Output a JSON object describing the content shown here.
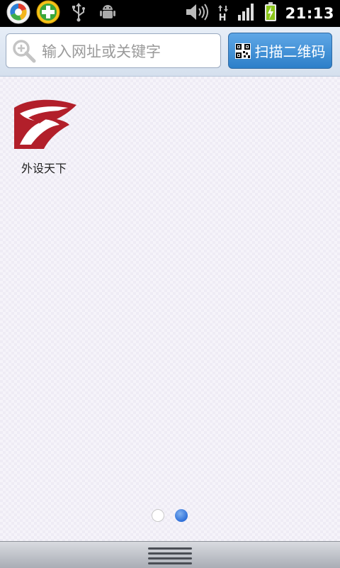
{
  "status_bar": {
    "time": "21:13",
    "left_icons": [
      "browser-app-icon",
      "plus-app-icon",
      "usb-icon",
      "android-debug-icon"
    ],
    "right_icons": [
      "volume-icon",
      "data-hsdpa-icon",
      "signal-icon",
      "battery-charging-icon"
    ],
    "network_label": "H"
  },
  "toolbar": {
    "search_placeholder": "输入网址或关键字",
    "scan_button_label": "扫描二维码"
  },
  "home": {
    "apps": [
      {
        "label": "外设天下",
        "icon": "eagle-logo-icon"
      }
    ],
    "pager": {
      "page_count": 2,
      "current_page": 2
    }
  },
  "colors": {
    "status_bar_bg": "#000000",
    "scan_button": "#3b8ad2",
    "logo_red": "#b21f2a",
    "active_dot": "#2e6fd8"
  }
}
